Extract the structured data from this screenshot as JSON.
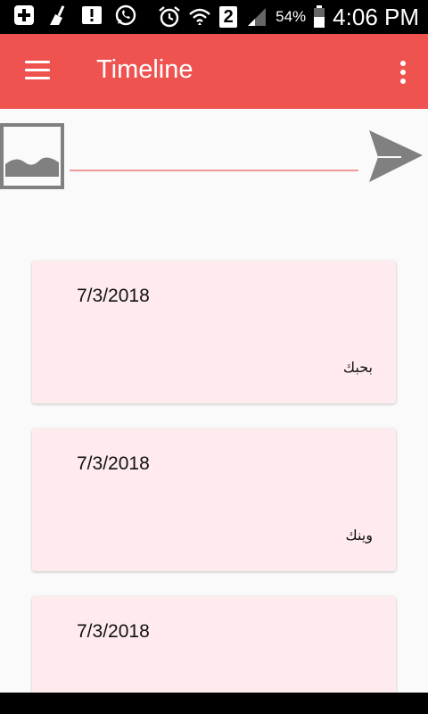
{
  "status_bar": {
    "battery_percent": "54%",
    "time": "4:06 PM",
    "sim_slot": "2",
    "icons": [
      "add-icon",
      "cleaner-icon",
      "alert-icon",
      "whatsapp-icon",
      "alarm-icon",
      "wifi-icon",
      "sim-icon",
      "signal-icon",
      "battery-icon"
    ]
  },
  "app_bar": {
    "title": "Timeline",
    "menu_icon": "hamburger-icon",
    "overflow_icon": "more-vert-icon",
    "color": "#EF5350"
  },
  "composer": {
    "image_icon": "image-placeholder-icon",
    "input_value": "",
    "send_icon": "send-icon"
  },
  "posts": [
    {
      "date": "7/3/2018",
      "text": "بحبك"
    },
    {
      "date": "7/3/2018",
      "text": "وينك"
    },
    {
      "date": "7/3/2018",
      "text": ""
    }
  ],
  "colors": {
    "card_bg": "#FFEBEE",
    "accent_line": "#EF9A9A",
    "icon_gray": "#808080"
  }
}
